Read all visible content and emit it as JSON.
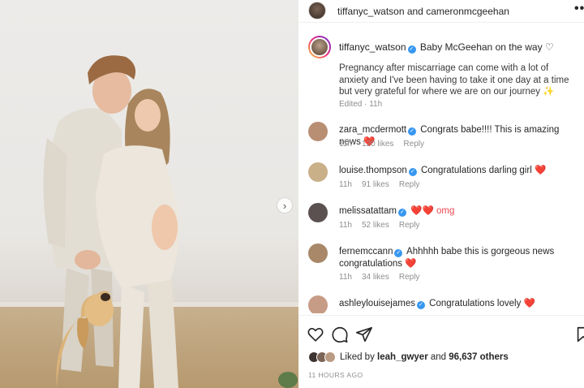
{
  "header": {
    "user1": "tiffanyc_watson",
    "joiner": " and ",
    "user2": "cameronmcgeehan",
    "more_icon": "more-horizontal-icon"
  },
  "caption": {
    "username": "tiffanyc_watson",
    "headline": "Baby McGeehan on the way ♡",
    "body": "Pregnancy after miscarriage can come with a lot of anxiety and I've been having to take it one day at a time but very grateful for where we are on our journey ✨",
    "edited": "Edited · 11h"
  },
  "comments": [
    {
      "username": "zara_mcdermott",
      "text": "Congrats babe!!!! This is amazing news",
      "emoji": "❤️",
      "time": "11h",
      "likes": "120 likes",
      "reply": "Reply",
      "avatar_color": "#b98f74"
    },
    {
      "username": "louise.thompson",
      "text": "Congratulations darling girl",
      "emoji": "❤️",
      "time": "11h",
      "likes": "91 likes",
      "reply": "Reply",
      "avatar_color": "#c9b089"
    },
    {
      "username": "melissatattam",
      "text": "",
      "emoji": "❤️❤️ omg",
      "time": "11h",
      "likes": "52 likes",
      "reply": "Reply",
      "avatar_color": "#5b5150"
    },
    {
      "username": "fernemccann",
      "text": "Ahhhhh babe this is gorgeous news congratulations",
      "emoji": "❤️",
      "time": "11h",
      "likes": "34 likes",
      "reply": "Reply",
      "avatar_color": "#a88868"
    },
    {
      "username": "ashleylouisejames",
      "text": "Congratulations lovely",
      "emoji": "❤️",
      "time": "",
      "likes": "",
      "reply": "",
      "avatar_color": "#c79c86"
    }
  ],
  "actions": {
    "like_icon": "heart-outline-icon",
    "comment_icon": "comment-icon",
    "share_icon": "send-icon",
    "save_icon": "bookmark-icon"
  },
  "likes": {
    "prefix": "Liked by ",
    "user": "leah_gwyer",
    "joiner": " and ",
    "count": "96,637 others"
  },
  "timestamp": "11 HOURS AGO",
  "colors": {
    "verified": "#3897f0",
    "heart": "#ed4956",
    "meta": "#8e8e8e"
  }
}
